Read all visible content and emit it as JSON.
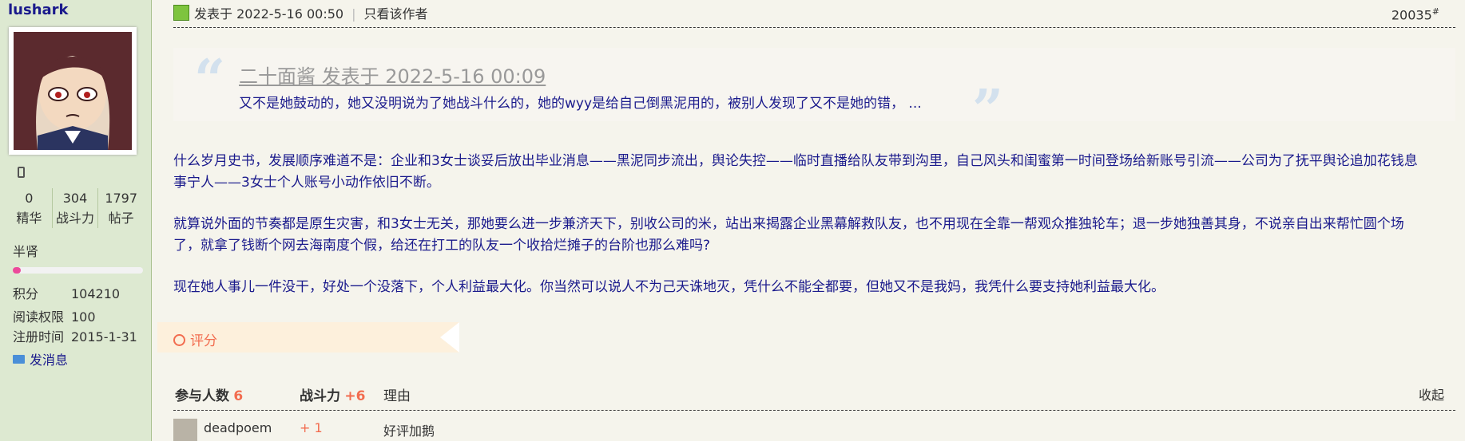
{
  "sidebar": {
    "username": "lushark",
    "avatar_icon": "anime-avatar",
    "phone_icon": "phone-icon",
    "stats": [
      {
        "value": "0",
        "label": "精华"
      },
      {
        "value": "304",
        "label": "战斗力"
      },
      {
        "value": "1797",
        "label": "帖子"
      }
    ],
    "rank": "半肾",
    "rank_progress": 0.06,
    "info": [
      {
        "key": "积分",
        "value": "104210"
      },
      {
        "key": "阅读权限",
        "value": "100"
      },
      {
        "key": "注册时间",
        "value": "2015-1-31"
      }
    ],
    "message_label": "发消息"
  },
  "post": {
    "posted_at": "发表于 2022-5-16 00:50",
    "only_author": "只看该作者",
    "floor": "20035",
    "floor_mark": "#",
    "quote": {
      "title": "二十面酱 发表于 2022-5-16 00:09",
      "text": "又不是她鼓动的，她又没明说为了她战斗什么的，她的wyy是给自己倒黑泥用的，被别人发现了又不是她的错，  ..."
    },
    "paragraphs": [
      "什么岁月史书，发展顺序难道不是：企业和3女士谈妥后放出毕业消息——黑泥同步流出，舆论失控——临时直播给队友带到沟里，自己风头和闺蜜第一时间登场给新账号引流——公司为了抚平舆论追加花钱息",
      "事宁人——3女士个人账号小动作依旧不断。",
      "就算说外面的节奏都是原生灾害，和3女士无关，那她要么进一步兼济天下，别收公司的米，站出来揭露企业黑幕解救队友，也不用现在全靠一帮观众推独轮车；退一步她独善其身，不说亲自出来帮忙圆个场",
      "了，就拿了钱断个网去海南度个假，给还在打工的队友一个收拾烂摊子的台阶也那么难吗?",
      "现在她人事儿一件没干，好处一个没落下，个人利益最大化。你当然可以说人不为己天诛地灭，凭什么不能全都要，但她又不是我妈，我凭什么要支持她利益最大化。"
    ]
  },
  "rating": {
    "label": "评分",
    "participants_label": "参与人数",
    "participants": "6",
    "power_label": "战斗力",
    "power": "+6",
    "reason_label": "理由",
    "collapse_label": "收起",
    "rows": [
      {
        "user": "deadpoem",
        "score": "+ 1",
        "reason": "好评加鹅"
      }
    ]
  },
  "colors": {
    "link": "#1a1a8c",
    "accent": "#f26c4f",
    "sidebar_bg": "#dde9d1"
  }
}
